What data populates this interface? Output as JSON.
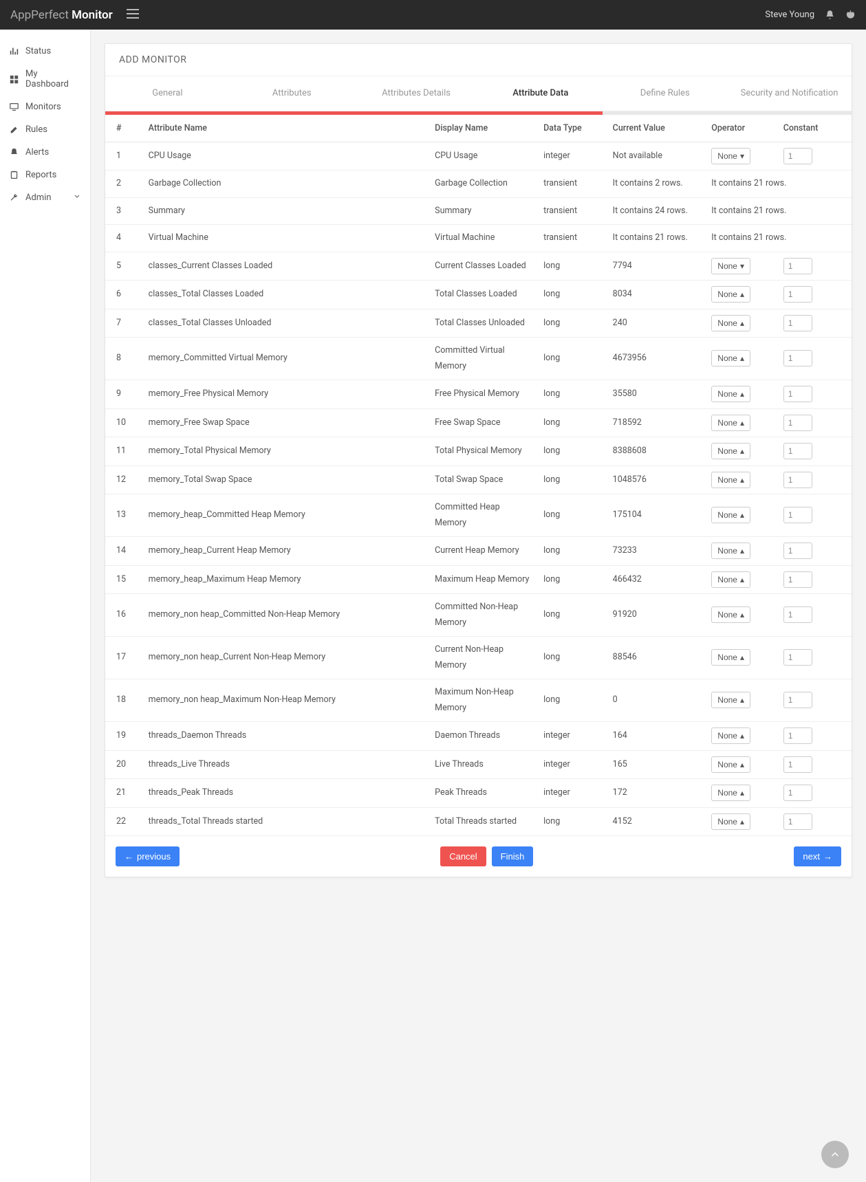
{
  "header": {
    "brand_light": "AppPerfect",
    "brand_bold": "Monitor",
    "user": "Steve Young"
  },
  "sidebar": {
    "items": [
      {
        "label": "Status",
        "icon": "bar-chart"
      },
      {
        "label": "My Dashboard",
        "icon": "grid"
      },
      {
        "label": "Monitors",
        "icon": "monitor"
      },
      {
        "label": "Rules",
        "icon": "pencil"
      },
      {
        "label": "Alerts",
        "icon": "bell"
      },
      {
        "label": "Reports",
        "icon": "clipboard"
      },
      {
        "label": "Admin",
        "icon": "wrench",
        "chevron": true
      }
    ]
  },
  "page": {
    "title": "ADD MONITOR",
    "tabs": [
      "General",
      "Attributes",
      "Attributes Details",
      "Attribute Data",
      "Define Rules",
      "Security and Notification"
    ],
    "active_tab": 3
  },
  "table": {
    "headers": [
      "#",
      "Attribute Name",
      "Display Name",
      "Data Type",
      "Current Value",
      "Operator",
      "Constant"
    ],
    "rows": [
      {
        "n": "1",
        "attr": "CPU Usage",
        "display": "CPU Usage",
        "type": "integer",
        "value": "Not available",
        "op": "None",
        "arrow": "down",
        "const": "1"
      },
      {
        "n": "2",
        "attr": "Garbage Collection",
        "display": "Garbage Collection",
        "type": "transient",
        "value": "It contains 2 rows.",
        "op_text": "It contains 21 rows."
      },
      {
        "n": "3",
        "attr": "Summary",
        "display": "Summary",
        "type": "transient",
        "value": "It contains 24 rows.",
        "op_text": "It contains 21 rows."
      },
      {
        "n": "4",
        "attr": "Virtual Machine",
        "display": "Virtual Machine",
        "type": "transient",
        "value": "It contains 21 rows.",
        "op_text": "It contains 21 rows."
      },
      {
        "n": "5",
        "attr": "classes_Current Classes Loaded",
        "display": "Current Classes Loaded",
        "type": "long",
        "value": "7794",
        "op": "None",
        "arrow": "down",
        "const": "1"
      },
      {
        "n": "6",
        "attr": "classes_Total Classes Loaded",
        "display": "Total Classes Loaded",
        "type": "long",
        "value": "8034",
        "op": "None",
        "arrow": "up",
        "const": "1"
      },
      {
        "n": "7",
        "attr": "classes_Total Classes Unloaded",
        "display": "Total Classes Unloaded",
        "type": "long",
        "value": "240",
        "op": "None",
        "arrow": "up",
        "const": "1"
      },
      {
        "n": "8",
        "attr": "memory_Committed Virtual Memory",
        "display": "Committed Virtual Memory",
        "type": "long",
        "value": "4673956",
        "op": "None",
        "arrow": "up",
        "const": "1"
      },
      {
        "n": "9",
        "attr": "memory_Free Physical Memory",
        "display": "Free Physical Memory",
        "type": "long",
        "value": "35580",
        "op": "None",
        "arrow": "up",
        "const": "1"
      },
      {
        "n": "10",
        "attr": "memory_Free Swap Space",
        "display": "Free Swap Space",
        "type": "long",
        "value": "718592",
        "op": "None",
        "arrow": "up",
        "const": "1"
      },
      {
        "n": "11",
        "attr": "memory_Total Physical Memory",
        "display": "Total Physical Memory",
        "type": "long",
        "value": "8388608",
        "op": "None",
        "arrow": "up",
        "const": "1"
      },
      {
        "n": "12",
        "attr": "memory_Total Swap Space",
        "display": "Total Swap Space",
        "type": "long",
        "value": "1048576",
        "op": "None",
        "arrow": "up",
        "const": "1"
      },
      {
        "n": "13",
        "attr": "memory_heap_Committed Heap Memory",
        "display": "Committed Heap Memory",
        "type": "long",
        "value": "175104",
        "op": "None",
        "arrow": "up",
        "const": "1"
      },
      {
        "n": "14",
        "attr": "memory_heap_Current Heap Memory",
        "display": "Current Heap Memory",
        "type": "long",
        "value": "73233",
        "op": "None",
        "arrow": "up",
        "const": "1"
      },
      {
        "n": "15",
        "attr": "memory_heap_Maximum Heap Memory",
        "display": "Maximum Heap Memory",
        "type": "long",
        "value": "466432",
        "op": "None",
        "arrow": "up",
        "const": "1"
      },
      {
        "n": "16",
        "attr": "memory_non heap_Committed Non-Heap Memory",
        "display": "Committed Non-Heap Memory",
        "type": "long",
        "value": "91920",
        "op": "None",
        "arrow": "up",
        "const": "1"
      },
      {
        "n": "17",
        "attr": "memory_non heap_Current Non-Heap Memory",
        "display": "Current Non-Heap Memory",
        "type": "long",
        "value": "88546",
        "op": "None",
        "arrow": "up",
        "const": "1"
      },
      {
        "n": "18",
        "attr": "memory_non heap_Maximum Non-Heap Memory",
        "display": "Maximum Non-Heap Memory",
        "type": "long",
        "value": "0",
        "op": "None",
        "arrow": "up",
        "const": "1"
      },
      {
        "n": "19",
        "attr": "threads_Daemon Threads",
        "display": "Daemon Threads",
        "type": "integer",
        "value": "164",
        "op": "None",
        "arrow": "up",
        "const": "1"
      },
      {
        "n": "20",
        "attr": "threads_Live Threads",
        "display": "Live Threads",
        "type": "integer",
        "value": "165",
        "op": "None",
        "arrow": "up",
        "const": "1"
      },
      {
        "n": "21",
        "attr": "threads_Peak Threads",
        "display": "Peak Threads",
        "type": "integer",
        "value": "172",
        "op": "None",
        "arrow": "up",
        "const": "1"
      },
      {
        "n": "22",
        "attr": "threads_Total Threads started",
        "display": "Total Threads started",
        "type": "long",
        "value": "4152",
        "op": "None",
        "arrow": "up",
        "const": "1"
      }
    ]
  },
  "buttons": {
    "previous": "previous",
    "cancel": "Cancel",
    "finish": "Finish",
    "next": "next"
  }
}
